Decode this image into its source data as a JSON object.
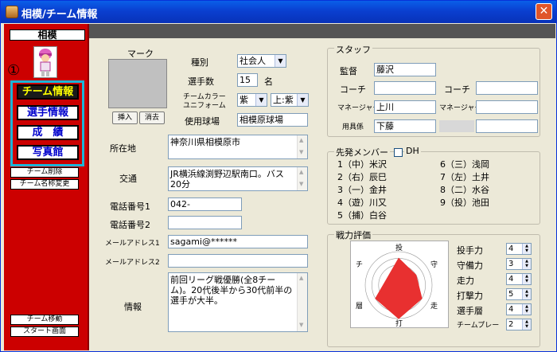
{
  "window": {
    "title": "相模/チーム情報",
    "close": "✕"
  },
  "sidebar": {
    "team_name": "相模",
    "marker": "①",
    "menu": [
      {
        "label": "チーム情報",
        "color": "#ffff00",
        "bg": "#1a1a1a"
      },
      {
        "label": "選手情報",
        "color": "#0000cc",
        "bg": "#ffffff"
      },
      {
        "label": "成　績",
        "color": "#0000cc",
        "bg": "#ffffff"
      },
      {
        "label": "写真館",
        "color": "#0000cc",
        "bg": "#ffffff"
      }
    ],
    "delete_team": "チーム削除",
    "rename_team": "チーム名称変更",
    "move_team": "チーム移動",
    "start_screen": "スタート画面"
  },
  "mark": {
    "label": "マーク",
    "insert": "挿入",
    "remove": "消去"
  },
  "basic": {
    "type_label": "種別",
    "type_value": "社会人",
    "players_label": "選手数",
    "players_value": "15",
    "players_unit": "名",
    "color_label1": "チームカラー",
    "color_label2": "ユニフォーム",
    "color1": "紫",
    "color2": "上:紫",
    "stadium_label": "使用球場",
    "stadium_value": "相模原球場"
  },
  "address": {
    "label": "所在地",
    "value": "神奈川県相模原市"
  },
  "access": {
    "label": "交通",
    "value": "JR横浜線渕野辺駅南口。バス20分"
  },
  "phone1": {
    "label": "電話番号1",
    "value": "042-"
  },
  "phone2": {
    "label": "電話番号2",
    "value": ""
  },
  "mail1": {
    "label": "メールアドレス1",
    "value": "sagami@******"
  },
  "mail2": {
    "label": "メールアドレス2",
    "value": ""
  },
  "info": {
    "label": "情報",
    "value": "前回リーグ戦優勝(全8チーム)。20代後半から30代前半の選手が大半。"
  },
  "staff": {
    "title": "スタッフ",
    "manager_label": "監督",
    "manager_value": "藤沢",
    "coach_label": "コーチ",
    "coach1": "",
    "coach2": "",
    "mgr_label": "マネージャー",
    "mgr1": "上川",
    "mgr2": "",
    "equip_label": "用具係",
    "equip_value": "下藤",
    "extra": ""
  },
  "lineup": {
    "title": "先発メンバー",
    "dh_label": "DH",
    "left": [
      {
        "num": "1",
        "pos": "（中）",
        "name": "米沢"
      },
      {
        "num": "2",
        "pos": "（右）",
        "name": "辰巳"
      },
      {
        "num": "3",
        "pos": "（一）",
        "name": "金井"
      },
      {
        "num": "4",
        "pos": "（遊）",
        "name": "川又"
      },
      {
        "num": "5",
        "pos": "（捕）",
        "name": "白谷"
      }
    ],
    "right": [
      {
        "num": "6",
        "pos": "（三）",
        "name": "浅岡"
      },
      {
        "num": "7",
        "pos": "（左）",
        "name": "土井"
      },
      {
        "num": "8",
        "pos": "（二）",
        "name": "水谷"
      },
      {
        "num": "9",
        "pos": "（投）",
        "name": "池田"
      }
    ]
  },
  "strength": {
    "title": "戦力評価",
    "axes": {
      "top": "投",
      "right": "守",
      "right_bottom": "走",
      "bottom": "打",
      "left_bottom": "層",
      "left": "チ"
    },
    "items": [
      {
        "label": "投手力",
        "value": "4"
      },
      {
        "label": "守備力",
        "value": "3"
      },
      {
        "label": "走力",
        "value": "4"
      },
      {
        "label": "打撃力",
        "value": "5"
      },
      {
        "label": "選手層",
        "value": "4"
      },
      {
        "label": "チームプレー",
        "value": "2"
      }
    ],
    "radar_values": [
      4,
      3,
      4,
      5,
      4,
      2
    ]
  }
}
